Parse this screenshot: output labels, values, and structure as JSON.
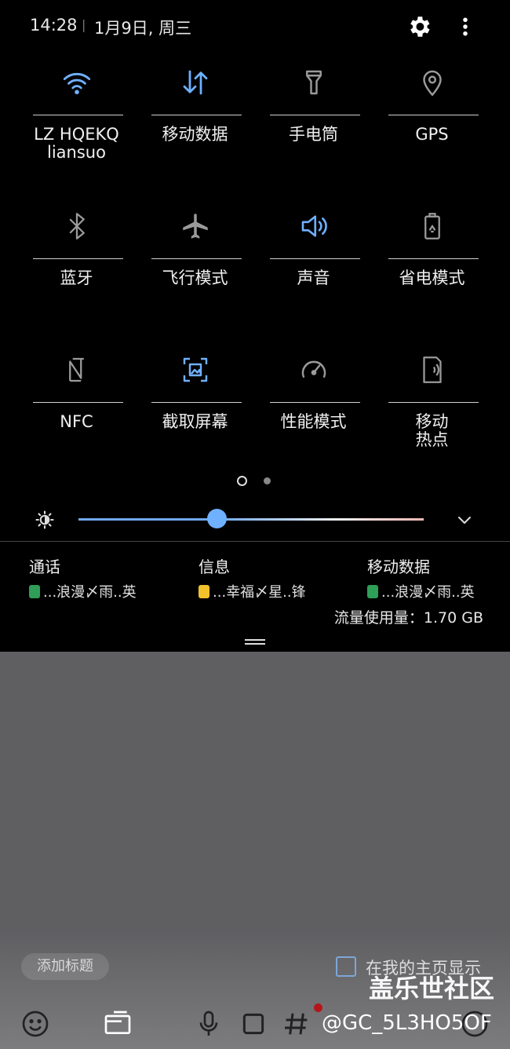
{
  "status_bar": {
    "time": "14:28",
    "separator": "|",
    "date": "1月9日, 周三",
    "icons": [
      "gear-icon",
      "more-vertical-icon"
    ]
  },
  "quick_settings": {
    "tiles": [
      {
        "label": "LZ HQEKQ\nliansuo",
        "icon": "wifi-icon",
        "active": true
      },
      {
        "label": "移动数据",
        "icon": "mobile-data-icon",
        "active": true
      },
      {
        "label": "手电筒",
        "icon": "flashlight-icon",
        "active": false
      },
      {
        "label": "GPS",
        "icon": "location-icon",
        "active": false
      },
      {
        "label": "蓝牙",
        "icon": "bluetooth-icon",
        "active": false
      },
      {
        "label": "飞行模式",
        "icon": "airplane-icon",
        "active": false
      },
      {
        "label": "声音",
        "icon": "sound-icon",
        "active": true
      },
      {
        "label": "省电模式",
        "icon": "battery-saver-icon",
        "active": false
      },
      {
        "label": "NFC",
        "icon": "nfc-icon",
        "active": false
      },
      {
        "label": "截取屏幕",
        "icon": "screenshot-icon",
        "active": true
      },
      {
        "label": "性能模式",
        "icon": "performance-icon",
        "active": false
      },
      {
        "label": "移动\n热点",
        "icon": "hotspot-icon",
        "active": false
      }
    ],
    "page_current": 1,
    "page_count": 2
  },
  "brightness": {
    "level": 0.4,
    "icon": "brightness-icon",
    "expand_icon": "chevron-down-icon"
  },
  "usage": {
    "columns": [
      {
        "title": "通话",
        "sim": "green",
        "name": "...浪漫〆雨..英"
      },
      {
        "title": "信息",
        "sim": "yellow",
        "name": "...幸福〆星..锋"
      },
      {
        "title": "移动数据",
        "sim": "green",
        "name": "...浪漫〆雨..英"
      }
    ],
    "total": "流量使用量：1.70 GB"
  },
  "below": {
    "add_title": "添加标题",
    "show_on_home": "在我的主页显示",
    "watermark": "盖乐世社区",
    "credit": "@GC_5L3HO5OF"
  },
  "colors": {
    "accent": "#6fb0ff",
    "inactive": "#9a9a9a",
    "background": "#000000",
    "lower_bg": "#5f5e61"
  }
}
